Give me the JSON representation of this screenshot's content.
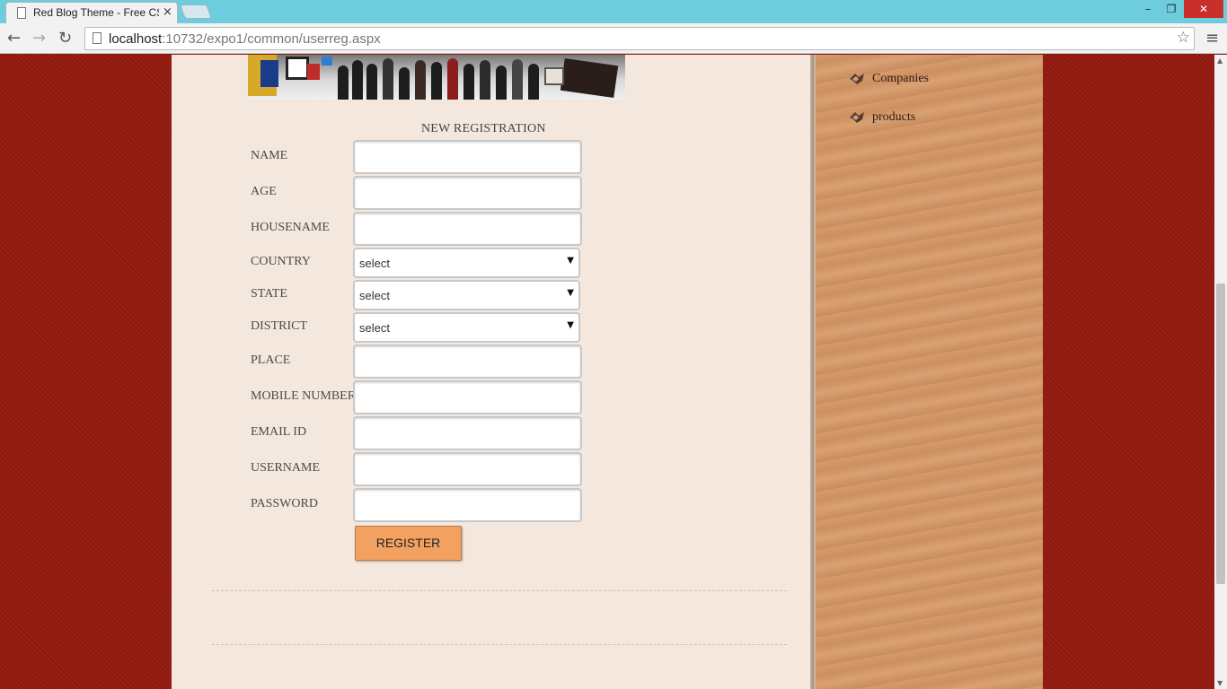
{
  "browser": {
    "tab_title": "Red Blog Theme - Free CSS",
    "tab_close": "×",
    "url_host": "localhost",
    "url_rest": ":10732/expo1/common/userreg.aspx",
    "win_min": "–",
    "win_max": "❐",
    "win_close": "✕",
    "back": "←",
    "forward": "→",
    "reload": "↻",
    "star": "☆",
    "menu": "≡"
  },
  "form": {
    "title": "NEW REGISTRATION",
    "fields": [
      {
        "label": "NAME",
        "type": "text",
        "value": ""
      },
      {
        "label": "AGE",
        "type": "text",
        "value": ""
      },
      {
        "label": "HOUSENAME",
        "type": "text",
        "value": ""
      },
      {
        "label": "COUNTRY",
        "type": "select",
        "value": "select"
      },
      {
        "label": "STATE",
        "type": "select",
        "value": "select"
      },
      {
        "label": "DISTRICT",
        "type": "select",
        "value": "select"
      },
      {
        "label": "PLACE",
        "type": "text",
        "value": ""
      },
      {
        "label": "MOBILE NUMBER",
        "type": "text",
        "value": ""
      },
      {
        "label": "EMAIL ID",
        "type": "text",
        "value": ""
      },
      {
        "label": "USERNAME",
        "type": "text",
        "value": ""
      },
      {
        "label": "PASSWORD",
        "type": "password",
        "value": ""
      }
    ],
    "select_arrow": "▼",
    "register_label": "REGISTER"
  },
  "sidebar": {
    "items": [
      {
        "label": "Companies",
        "icon": "ribbon-icon"
      },
      {
        "label": "products",
        "icon": "ribbon-icon"
      }
    ]
  },
  "colors": {
    "background": "#8e1a0f",
    "content": "#f4e8de",
    "sidebar": "#d69a6c",
    "button": "#f3a161",
    "chrome_title": "#6ecddd"
  }
}
